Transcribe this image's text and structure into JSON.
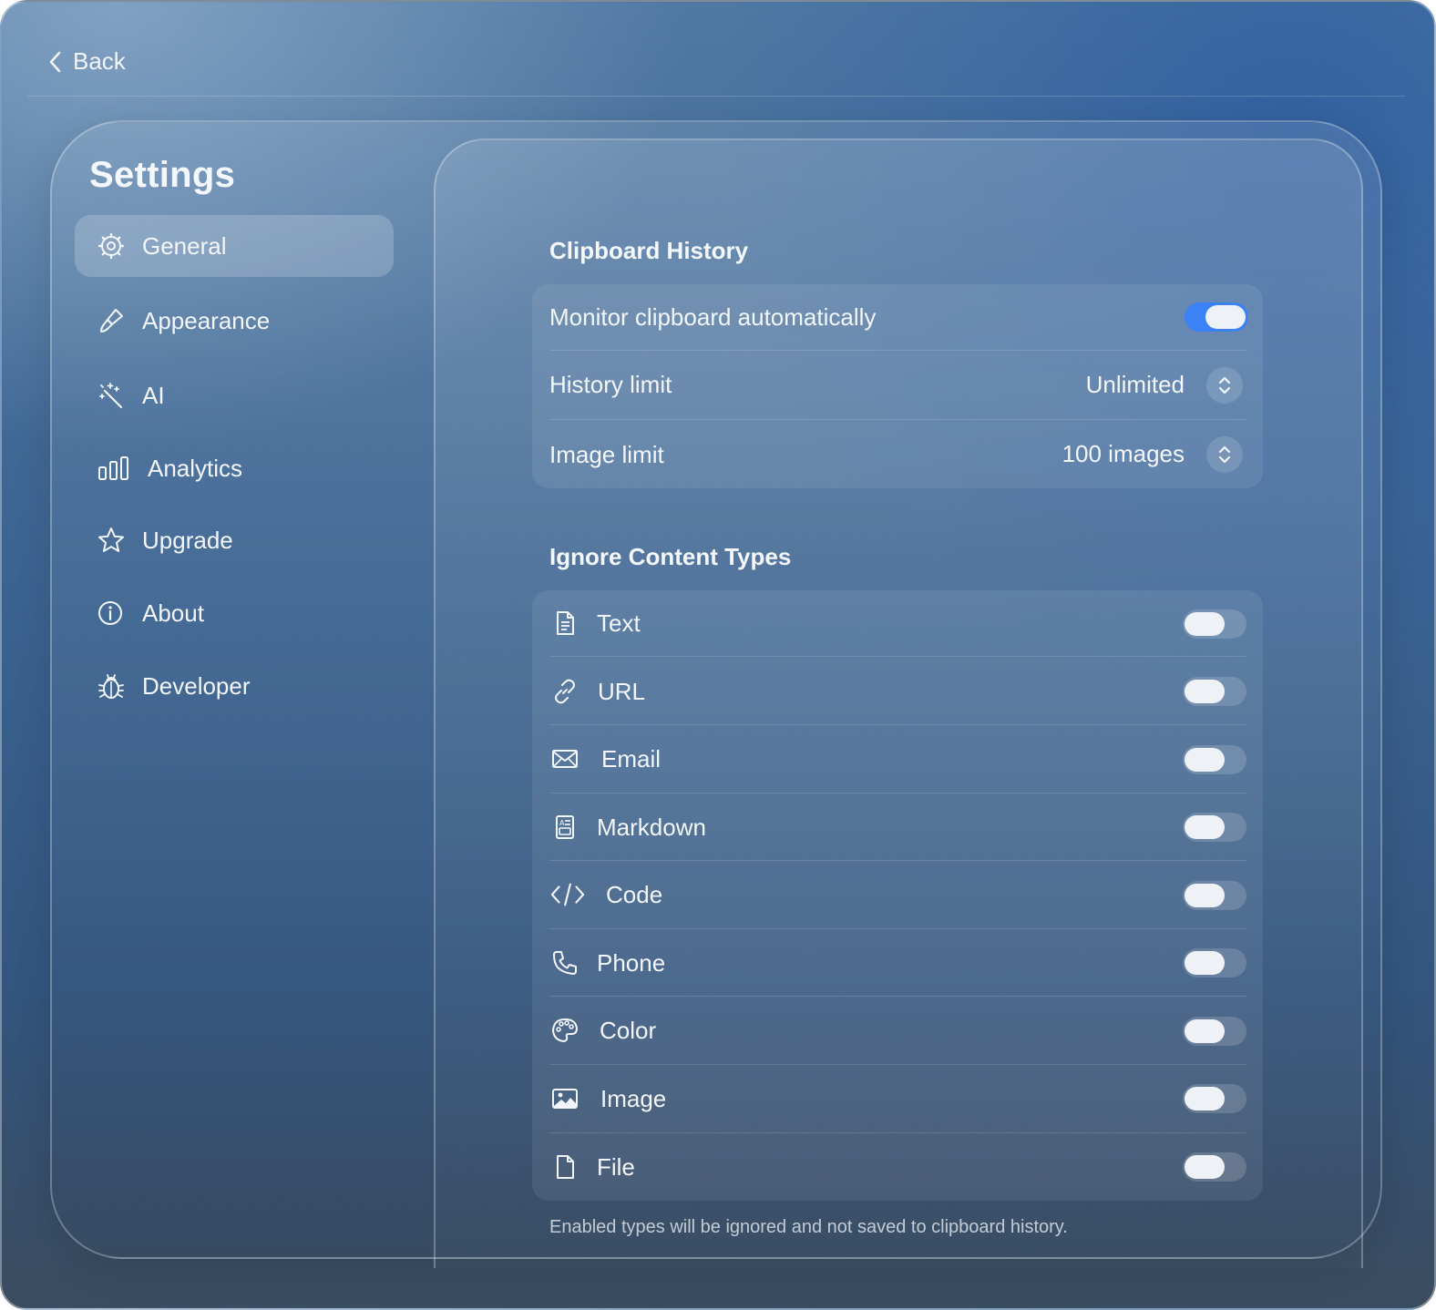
{
  "header": {
    "back_label": "Back"
  },
  "sidebar": {
    "title": "Settings",
    "items": [
      {
        "label": "General",
        "icon": "gear-icon",
        "active": true
      },
      {
        "label": "Appearance",
        "icon": "paintbrush-icon",
        "active": false
      },
      {
        "label": "AI",
        "icon": "magic-wand-icon",
        "active": false
      },
      {
        "label": "Analytics",
        "icon": "bar-chart-icon",
        "active": false
      },
      {
        "label": "Upgrade",
        "icon": "star-icon",
        "active": false
      },
      {
        "label": "About",
        "icon": "info-icon",
        "active": false
      },
      {
        "label": "Developer",
        "icon": "bug-icon",
        "active": false
      }
    ]
  },
  "clipboard_history": {
    "title": "Clipboard History",
    "monitor": {
      "label": "Monitor clipboard automatically",
      "enabled": true
    },
    "history_limit": {
      "label": "History limit",
      "value": "Unlimited"
    },
    "image_limit": {
      "label": "Image limit",
      "value": "100 images"
    }
  },
  "ignore_types": {
    "title": "Ignore Content Types",
    "items": [
      {
        "label": "Text",
        "icon": "document-text-icon",
        "enabled": false
      },
      {
        "label": "URL",
        "icon": "link-icon",
        "enabled": false
      },
      {
        "label": "Email",
        "icon": "envelope-icon",
        "enabled": false
      },
      {
        "label": "Markdown",
        "icon": "markdown-doc-icon",
        "enabled": false
      },
      {
        "label": "Code",
        "icon": "code-brackets-icon",
        "enabled": false
      },
      {
        "label": "Phone",
        "icon": "phone-icon",
        "enabled": false
      },
      {
        "label": "Color",
        "icon": "palette-icon",
        "enabled": false
      },
      {
        "label": "Image",
        "icon": "photo-icon",
        "enabled": false
      },
      {
        "label": "File",
        "icon": "file-icon",
        "enabled": false
      }
    ],
    "footnote": "Enabled types will be ignored and not saved to clipboard history."
  },
  "colors": {
    "toggle_on": "#3b82f6",
    "accent_background": "#3b6391"
  }
}
